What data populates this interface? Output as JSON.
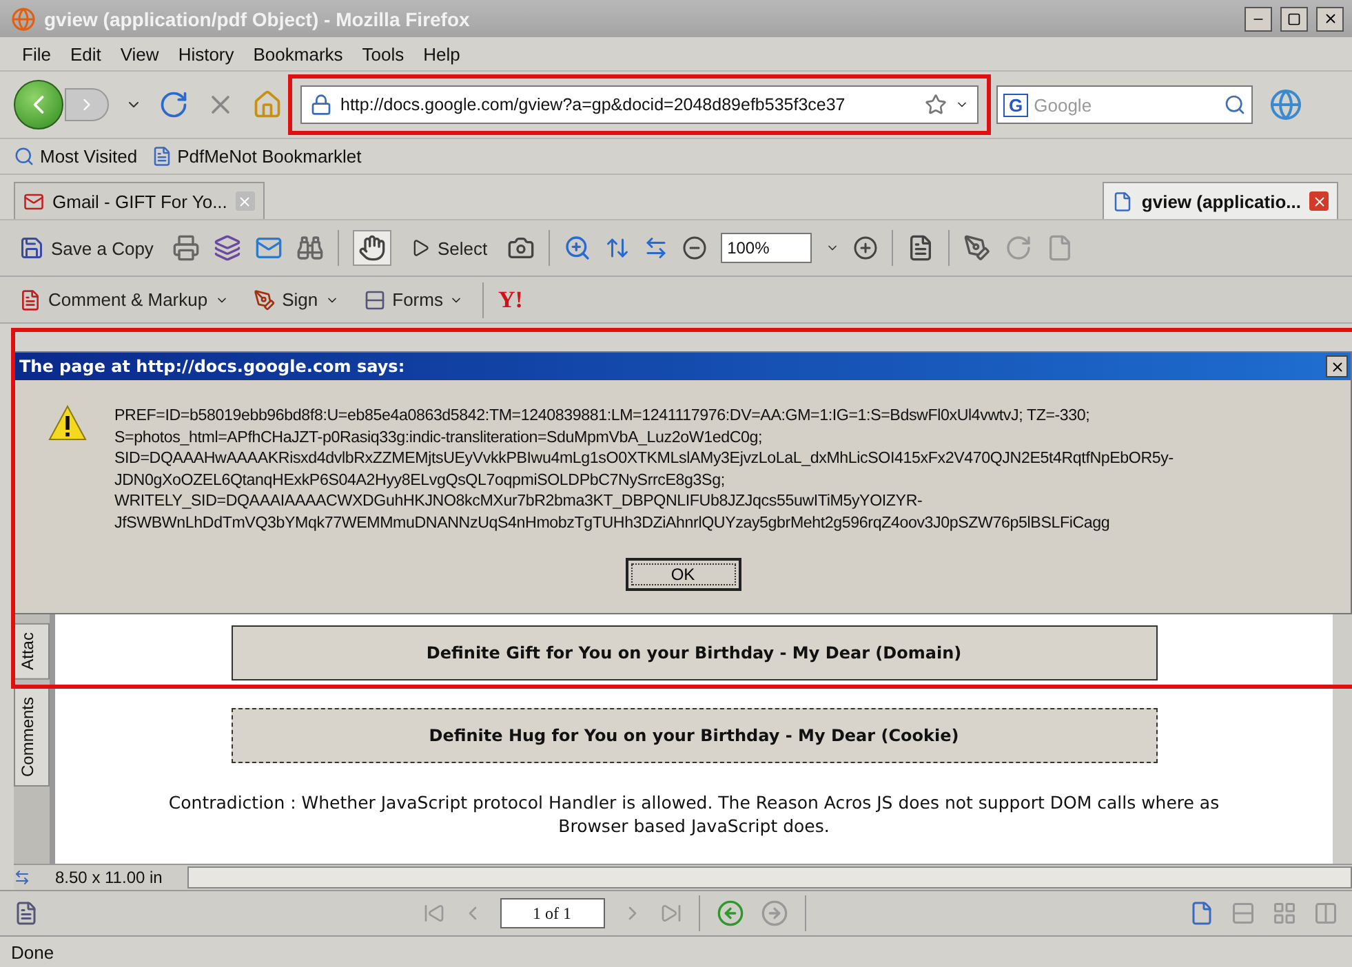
{
  "window": {
    "title": "gview (application/pdf Object) - Mozilla Firefox"
  },
  "menu": [
    "File",
    "Edit",
    "View",
    "History",
    "Bookmarks",
    "Tools",
    "Help"
  ],
  "nav": {
    "url": "http://docs.google.com/gview?a=gp&docid=2048d89efb535f3ce37",
    "search_placeholder": "Google",
    "engine_badge": "G"
  },
  "bookmarks": [
    "Most Visited",
    "PdfMeNot Bookmarklet"
  ],
  "tabs": [
    {
      "label": "Gmail - GIFT For Yo...",
      "selected": false
    },
    {
      "label": "gview (applicatio...",
      "selected": true
    }
  ],
  "pdf_toolbar": {
    "save_label": "Save a Copy",
    "select_label": "Select",
    "zoom": "100%",
    "hand_tool_active": true
  },
  "pdf_toolbar2": [
    {
      "label": "Comment & Markup"
    },
    {
      "label": "Sign"
    },
    {
      "label": "Forms"
    }
  ],
  "toolbar_logo": "Y!",
  "dialog": {
    "title": "The page at http://docs.google.com says:",
    "lines": [
      "PREF=ID=b58019ebb96bd8f8:U=eb85e4a0863d5842:TM=1240839881:LM=1241117976:DV=AA:GM=1:IG=1:S=BdswFl0xUl4vwtvJ; TZ=-330;",
      "S=photos_html=APfhCHaJZT-p0Rasiq33g:indic-transliteration=SduMpmVbA_Luz2oW1edC0g;",
      "SID=DQAAAHwAAAAKRisxd4dvlbRxZZMEMjtsUEyVvkkPBIwu4mLg1sO0XTKMLslAMy3EjvzLoLaL_dxMhLicSOI415xFx2V470QJN2E5t4RqtfNpEbOR5y-",
      "JDN0gXoOZEL6QtanqHExkP6S04A2Hyy8ELvgQsQL7oqpmiSOLDPbC7NySrrcE8g3Sg;",
      "WRITELY_SID=DQAAAIAAAACWXDGuhHKJNO8kcMXur7bR2bma3KT_DBPQNLIFUb8JZJqcs55uwITiM5yYOIZYR-",
      "JfSWBWnLhDdTmVQ3bYMqk77WEMMmuDNANNzUqS4nHmobzTgTUHh3DZiAhnrlQUYzay5gbrMeht2g596rqZ4oov3J0pSZW76p5lBSLFiCagg"
    ],
    "button": "OK"
  },
  "side_tabs": [
    "Attac",
    "Comments"
  ],
  "document": {
    "buttons": [
      "Definite Gift for You on your Birthday - My Dear (Domain)",
      "Definite Hug for You on your Birthday - My Dear (Cookie)"
    ],
    "paragraph": "Contradiction : Whether JavaScript protocol Handler is allowed. The Reason Acros JS does not support DOM calls where as Browser based JavaScript does."
  },
  "page_size": "8.50 x 11.00 in",
  "page_field": "1 of 1",
  "status": "Done"
}
